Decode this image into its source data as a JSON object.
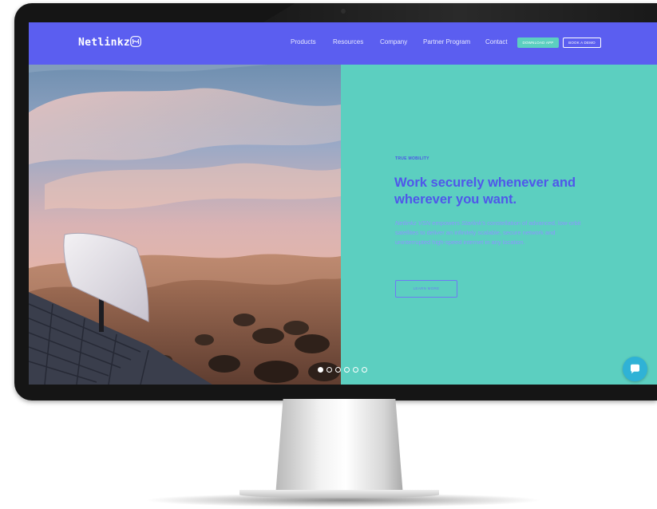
{
  "navbar": {
    "logo_text": "Netlinkz",
    "logo_icon": "netlinkz-logo-icon",
    "links": [
      "Products",
      "Resources",
      "Company",
      "Partner Program",
      "Contact"
    ],
    "download_button": "DOWNLOAD APP",
    "demo_button": "BOOK A DEMO"
  },
  "hero": {
    "eyebrow": "TRUE MOBILITY",
    "headline": "Work securely whenever and wherever you want.",
    "body_brand": "Netlinkz VSN",
    "body_part1": " empowers ",
    "body_starlink": "Starlink's",
    "body_part2": " constellation of advanced, low-orbit satellites to deliver an infinitely scalable, secure network and uninterrupted high-speed internet in any location.",
    "cta_button": "LEARN MORE",
    "slides_total": 6,
    "slide_active": 1
  },
  "widgets": {
    "chat_icon": "chat-bubble-icon"
  },
  "colors": {
    "nav_bg": "#5b5ef0",
    "hero_bg": "#5ccfc0",
    "accent_text": "#4f57ea",
    "chat_bg": "#2fb2d6"
  }
}
